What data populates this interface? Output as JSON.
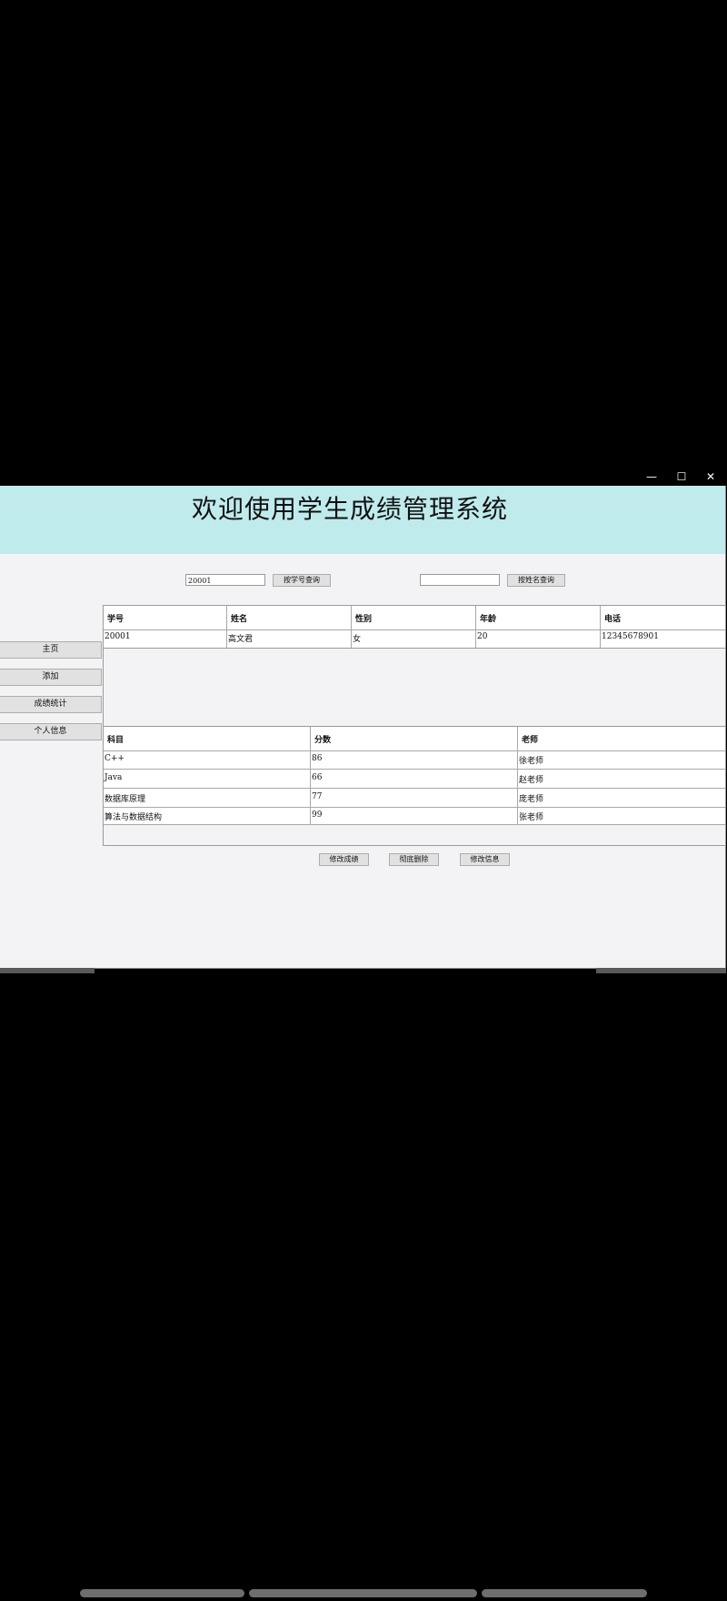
{
  "window": {
    "title": "",
    "controls": {
      "minimize": "—",
      "maximize": "☐",
      "close": "✕"
    }
  },
  "banner": {
    "title": "欢迎使用学生成绩管理系统"
  },
  "search": {
    "id_value": "20001",
    "id_button": "按学号查询",
    "name_value": "",
    "name_button": "按姓名查询"
  },
  "sidebar": {
    "items": [
      {
        "label": "主页"
      },
      {
        "label": "添加"
      },
      {
        "label": "成绩统计"
      },
      {
        "label": "个人信息"
      }
    ]
  },
  "student_table": {
    "headers": [
      "学号",
      "姓名",
      "性别",
      "年龄",
      "电话"
    ],
    "rows": [
      [
        "20001",
        "高文君",
        "女",
        "20",
        "12345678901"
      ]
    ]
  },
  "score_table": {
    "headers": [
      "科目",
      "分数",
      "老师"
    ],
    "rows": [
      [
        "C++",
        "86",
        "徐老师"
      ],
      [
        "Java",
        "66",
        "赵老师"
      ],
      [
        "数据库原理",
        "77",
        "庞老师"
      ],
      [
        "算法与数据结构",
        "99",
        "张老师"
      ]
    ]
  },
  "actions": {
    "edit_score": "修改成绩",
    "delete": "彻底删除",
    "edit_info": "修改信息"
  }
}
